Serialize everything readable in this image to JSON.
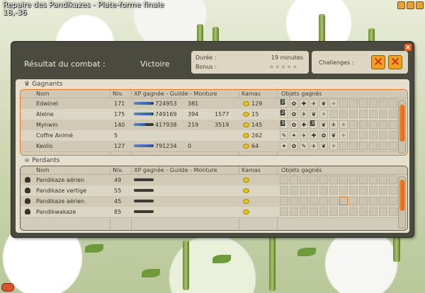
{
  "map": {
    "title": "Repaire des Pandikazes - Plate-forme finale",
    "coords": "18,-36"
  },
  "window": {
    "title": "Résultat du combat :",
    "result": "Victoire",
    "duration_label": "Durée :",
    "duration_value": "19 minutes",
    "bonus_label": "Bonus :",
    "bonus_stars": 5,
    "challenges_label": "Challenges :",
    "close_label": "x"
  },
  "winners": {
    "title": "Gagnants",
    "columns": [
      "Nom",
      "Niv.",
      "XP gagnée - Guilde - Monture",
      "Kamas",
      "Objets gagnés"
    ],
    "rows": [
      {
        "name": "Edwinel",
        "level": "171",
        "xp": "724953",
        "guild": "381",
        "mount": "",
        "kamas": "129",
        "xp_fill": 0.9,
        "items": [
          {
            "q": "2",
            "g": "✦"
          },
          {
            "q": "",
            "g": "✿"
          },
          {
            "q": "",
            "g": "✚"
          },
          {
            "q": "",
            "g": "✈"
          },
          {
            "q": "",
            "g": "❦"
          },
          {
            "q": "",
            "g": "✧"
          }
        ]
      },
      {
        "name": "Alelne",
        "level": "175",
        "xp": "749169",
        "guild": "394",
        "mount": "1577",
        "kamas": "15",
        "xp_fill": 0.92,
        "items": [
          {
            "q": "2",
            "g": "✦"
          },
          {
            "q": "",
            "g": "✿"
          },
          {
            "q": "",
            "g": "✈"
          },
          {
            "q": "",
            "g": "❦"
          },
          {
            "q": "",
            "g": "✧"
          }
        ]
      },
      {
        "name": "Mynwin",
        "level": "140",
        "xp": "417938",
        "guild": "219",
        "mount": "3519",
        "kamas": "145",
        "xp_fill": 0.6,
        "items": [
          {
            "q": "3",
            "g": "✦"
          },
          {
            "q": "",
            "g": "✿"
          },
          {
            "q": "",
            "g": "✚"
          },
          {
            "q": "3",
            "g": "✦"
          },
          {
            "q": "",
            "g": "❦"
          },
          {
            "q": "",
            "g": "✈"
          },
          {
            "q": "",
            "g": "✧"
          }
        ]
      },
      {
        "name": "Coffre Animé",
        "level": "5",
        "xp": "",
        "guild": "",
        "mount": "",
        "kamas": "262",
        "xp_fill": 0,
        "items": [
          {
            "q": "",
            "g": "✎"
          },
          {
            "q": "",
            "g": "✦"
          },
          {
            "q": "",
            "g": "✈"
          },
          {
            "q": "",
            "g": "✚"
          },
          {
            "q": "",
            "g": "✿"
          },
          {
            "q": "",
            "g": "❦"
          },
          {
            "q": "",
            "g": "✧"
          }
        ]
      },
      {
        "name": "Keolis",
        "level": "127",
        "xp": "791234",
        "guild": "0",
        "mount": "",
        "kamas": "64",
        "xp_fill": 0.95,
        "items": [
          {
            "q": "",
            "g": "✦"
          },
          {
            "q": "",
            "g": "✿"
          },
          {
            "q": "",
            "g": "✎"
          },
          {
            "q": "",
            "g": "✈"
          },
          {
            "q": "",
            "g": "❦"
          },
          {
            "q": "",
            "g": "✧"
          }
        ]
      }
    ]
  },
  "losers": {
    "title": "Perdants",
    "columns": [
      "Nom",
      "Niv.",
      "XP gagnée - Guilde - Monture",
      "Kamas",
      "Objets gagnés"
    ],
    "rows": [
      {
        "name": "Pandikaze aérien",
        "level": "49"
      },
      {
        "name": "Pandikaze vertige",
        "level": "55"
      },
      {
        "name": "Pandikaze aérien",
        "level": "45"
      },
      {
        "name": "Pandikwakaze",
        "level": "85"
      }
    ]
  },
  "colors": {
    "accent": "#e07a2a",
    "panel": "#e4dfcf",
    "frame": "#4a4a3f"
  }
}
